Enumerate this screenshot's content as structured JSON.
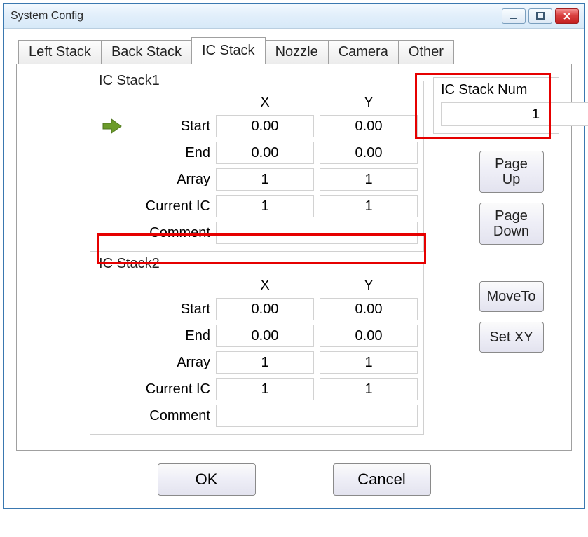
{
  "window": {
    "title": "System Config"
  },
  "tabs": [
    {
      "label": "Left Stack"
    },
    {
      "label": "Back Stack"
    },
    {
      "label": "IC Stack",
      "active": true
    },
    {
      "label": "Nozzle"
    },
    {
      "label": "Camera"
    },
    {
      "label": "Other"
    }
  ],
  "headers": {
    "x": "X",
    "y": "Y"
  },
  "row_labels": {
    "start": "Start",
    "end": "End",
    "array": "Array",
    "current_ic": "Current IC",
    "comment": "Comment"
  },
  "stack1": {
    "legend": "IC Stack1",
    "start": {
      "x": "0.00",
      "y": "0.00"
    },
    "end": {
      "x": "0.00",
      "y": "0.00"
    },
    "array": {
      "x": "1",
      "y": "1"
    },
    "current_ic": {
      "x": "1",
      "y": "1"
    },
    "comment": ""
  },
  "stack2": {
    "legend": "IC Stack2",
    "start": {
      "x": "0.00",
      "y": "0.00"
    },
    "end": {
      "x": "0.00",
      "y": "0.00"
    },
    "array": {
      "x": "1",
      "y": "1"
    },
    "current_ic": {
      "x": "1",
      "y": "1"
    },
    "comment": ""
  },
  "side": {
    "stack_num_label": "IC Stack Num",
    "stack_num_value": "1",
    "page_up": "Page\nUp",
    "page_down": "Page\nDown",
    "move_to": "MoveTo",
    "set_xy": "Set XY"
  },
  "buttons": {
    "ok": "OK",
    "cancel": "Cancel"
  }
}
